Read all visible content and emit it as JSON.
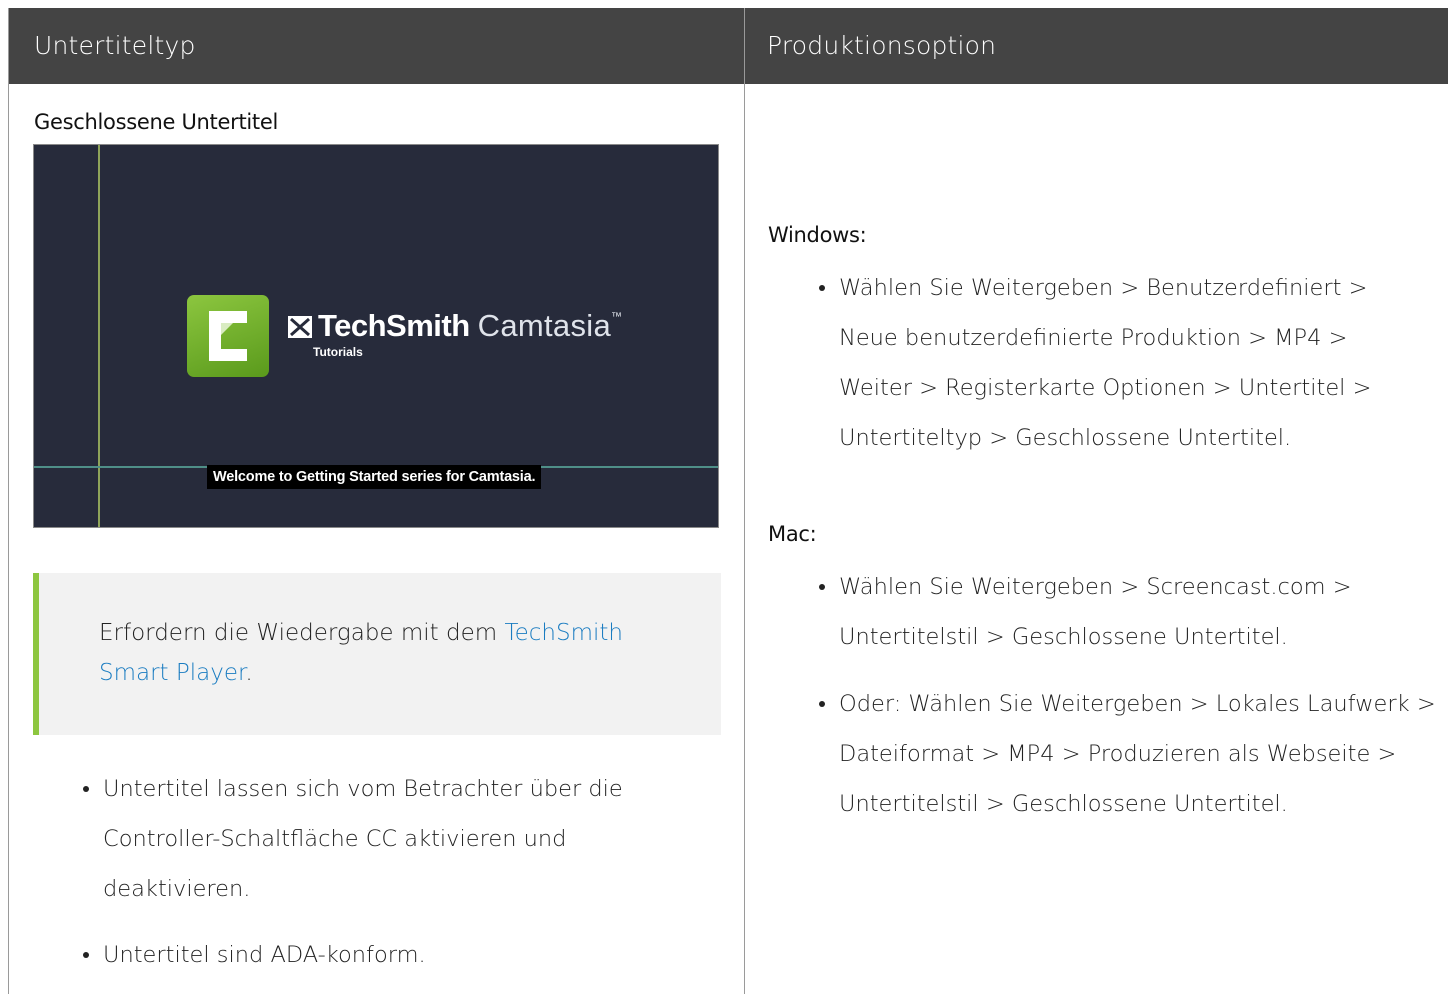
{
  "table": {
    "header": {
      "col1": "Untertiteltyp",
      "col2": "Produktionsoption"
    },
    "left": {
      "heading": "Geschlossene Untertitel",
      "preview": {
        "brand_name_bold": "TechSmith",
        "brand_name": "Camtasia",
        "brand_tm": "™",
        "brand_sub": "Tutorials",
        "caption": "Welcome to Getting Started series for Camtasia.",
        "logo_color": "#7ab82e",
        "background_color": "#272b3b"
      },
      "note": {
        "text_before": "Erfordern die Wiedergabe mit dem ",
        "link": "TechSmith Smart Player",
        "text_after": ".",
        "accent_color": "#8dc63f",
        "link_color": "#1a7cc1"
      },
      "bullets": [
        "Untertitel lassen sich vom Betrachter über die Controller-Schaltfläche CC aktivieren und deaktivieren.",
        "Untertitel sind ADA-konform."
      ]
    },
    "right": {
      "windows": {
        "heading": "Windows:",
        "bullets": [
          "Wählen Sie Weitergeben > Benutzerdefiniert > Neue benutzerdefinierte Produktion > MP4 > Weiter > Registerkarte Optionen > Untertitel > Untertiteltyp > Geschlossene Untertitel."
        ]
      },
      "mac": {
        "heading": "Mac:",
        "bullets": [
          "Wählen Sie Weitergeben > Screencast.com > Untertitelstil > Geschlossene Untertitel.",
          "Oder: Wählen Sie Weitergeben > Lokales Laufwerk > Dateiformat > MP4 > Produzieren als Webseite > Untertitelstil > Geschlossene Untertitel."
        ]
      }
    },
    "header_color": "#444444"
  }
}
